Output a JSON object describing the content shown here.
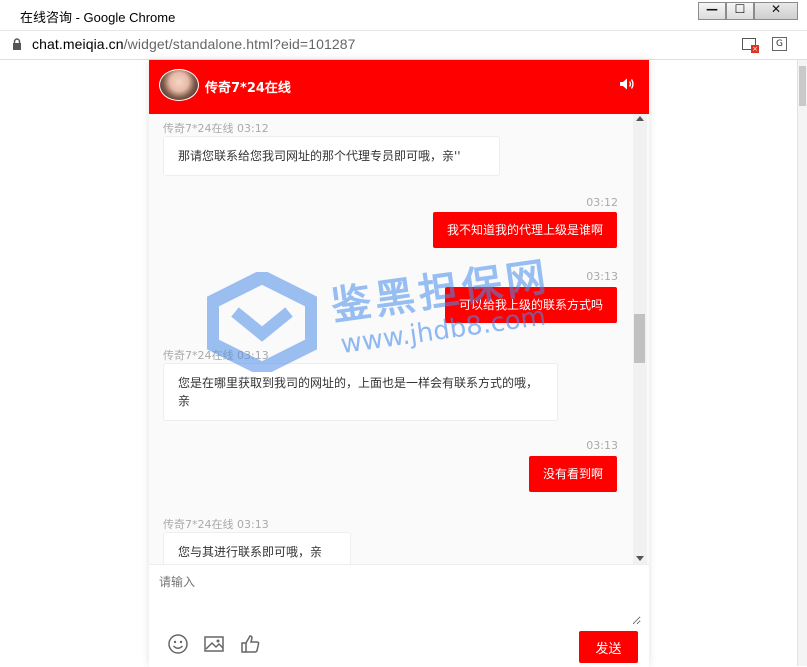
{
  "browser": {
    "window_title": "在线咨询 - Google Chrome",
    "url_host": "chat.meiqia.cn",
    "url_path": "/widget/standalone.html?eid=101287",
    "controls": {
      "minimize": "—",
      "maximize": "☐",
      "close": "✕"
    }
  },
  "chat": {
    "agent_name": "传奇7*24在线",
    "messages": [
      {
        "from": "agent",
        "meta": "传奇7*24在线 03:12",
        "text": "那请您联系给您我司网址的那个代理专员即可哦，亲''"
      },
      {
        "from": "user",
        "meta": "03:12",
        "text": "我不知道我的代理上级是谁啊"
      },
      {
        "from": "user",
        "meta": "03:13",
        "text": "可以给我上级的联系方式吗"
      },
      {
        "from": "agent",
        "meta": "传奇7*24在线 03:13",
        "text": "您是在哪里获取到我司的网址的，上面也是一样会有联系方式的哦，亲"
      },
      {
        "from": "user",
        "meta": "03:13",
        "text": "没有看到啊"
      },
      {
        "from": "agent",
        "meta": "传奇7*24在线 03:13",
        "text": "您与其进行联系即可哦，亲"
      }
    ],
    "composer": {
      "placeholder": "请输入",
      "send_label": "发送"
    },
    "watermark": {
      "title": "鉴黑担保网",
      "url": "www.jhdb8.com"
    },
    "colors": {
      "accent": "#ff0000",
      "bubble_in": "#ffffff",
      "meta": "#aaaaaa"
    }
  }
}
